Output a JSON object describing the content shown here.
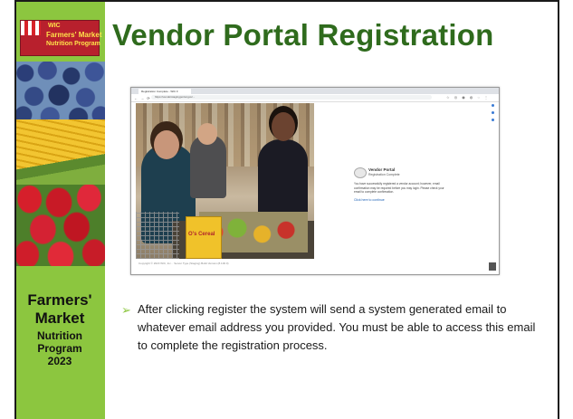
{
  "logo": {
    "org": "WIC",
    "line1": "Farmers' Market",
    "line2": "Nutrition Program"
  },
  "sidebar": {
    "line1": "Farmers'",
    "line2": "Market",
    "line3": "Nutrition",
    "line4": "Program",
    "line5": "2023"
  },
  "title": "Vendor Portal Registration",
  "screenshot": {
    "tab_label": "Registration Complete - WIC F",
    "address": "https://vendorstagingportal.gov/...",
    "photo_box_label": "O's Cereal",
    "card_title": "Vendor Portal",
    "card_subtitle": "Registration Complete",
    "card_body": "You have successfully registered a vendor account; however, email confirmation may be required before you may login. Please check your email to complete confirmation.",
    "card_link": "Click here to continue",
    "footer": "Copyright © 2023 WIC, Inc. · Server Type (Staging) Build Version (8.100.0)"
  },
  "bullet_text": "After clicking register the system will send a system generated email to whatever email address you provided. You must be able to access this email to complete the registration process.",
  "colors": {
    "sidebar": "#8cc63f",
    "title": "#2f6b1d",
    "bullet": "#8cc63f"
  }
}
